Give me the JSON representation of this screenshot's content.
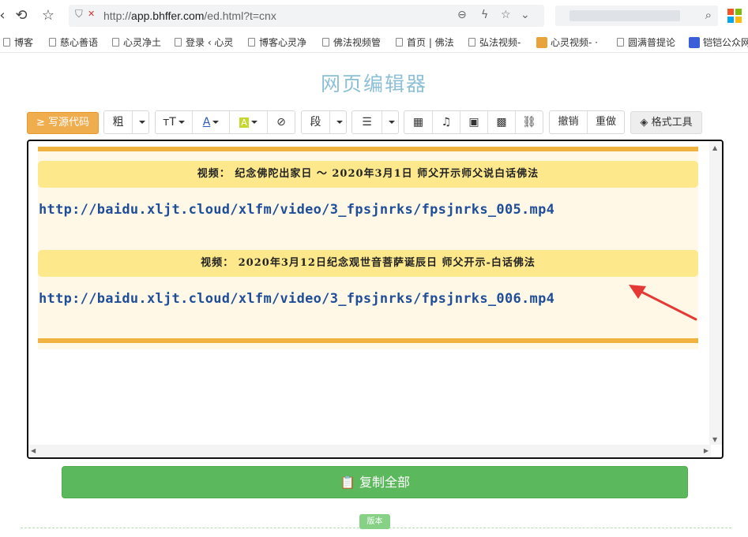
{
  "browser": {
    "address_prefix": "http://",
    "address_host": "app.bhffer.com",
    "address_path": "/ed.html?t=cnx",
    "bookmarks": [
      "博客",
      "慈心善语",
      "心灵净土",
      "登录 ‹ 心灵",
      "博客心灵净",
      "佛法视频管",
      "首页 | 佛法",
      "弘法视频-",
      "心灵视频- ·",
      "圆满普提论",
      "铠铠公众网"
    ]
  },
  "page": {
    "title": "网页编辑器"
  },
  "toolbar": {
    "source_label": "写源代码",
    "bold_label": "粗",
    "paragraph_label": "段",
    "undo_label": "撤销",
    "redo_label": "重做",
    "format_tool_label": "格式工具"
  },
  "content": {
    "items": [
      {
        "title": "视频： 纪念佛陀出家日 ～ 2020年3月1日 师父开示师父说白话佛法",
        "url": "http://baidu.xljt.cloud/xlfm/video/3_fpsjnrks/fpsjnrks_005.mp4"
      },
      {
        "title": "视频： 2020年3月12日纪念观世音菩萨诞辰日 师父开示-白话佛法",
        "url": "http://baidu.xljt.cloud/xlfm/video/3_fpsjnrks/fpsjnrks_006.mp4"
      }
    ]
  },
  "actions": {
    "copy_all_label": "复制全部",
    "version_label": "版本"
  },
  "colors": {
    "accent_orange": "#f0ad4e",
    "copy_green": "#5cb85c",
    "title_blue": "#8dc0d6",
    "stripe": "#f0b33f",
    "title_bar": "#fde98c",
    "link_blue": "#1f4e99",
    "arrow_red": "#e53935"
  }
}
